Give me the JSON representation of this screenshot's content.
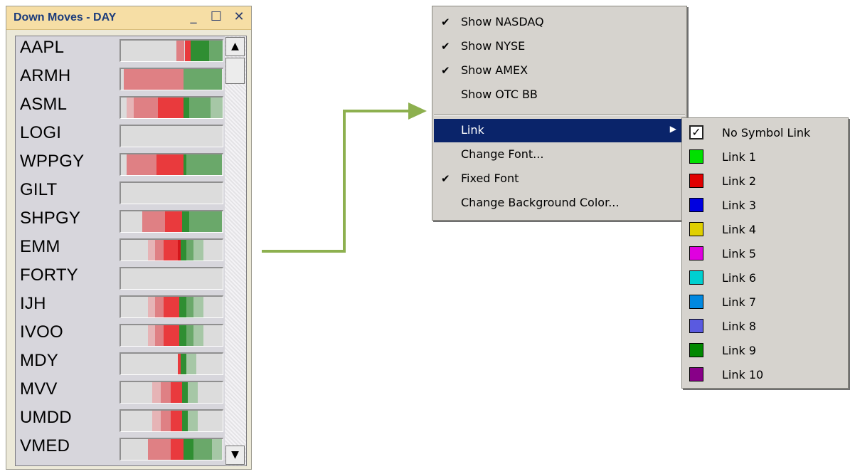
{
  "window": {
    "title": "Down Moves - DAY",
    "controls": {
      "minimize": "_",
      "maximize": "☐",
      "close": "✕"
    }
  },
  "scroll": {
    "up": "▲",
    "down": "▼"
  },
  "rows": [
    {
      "symbol": "AAPL",
      "segments": [
        [
          "light-red",
          78,
          11
        ],
        [
          "red",
          90,
          8
        ],
        [
          "green",
          98,
          26
        ],
        [
          "mid-green",
          124,
          22
        ]
      ]
    },
    {
      "symbol": "ARMH",
      "segments": [
        [
          "light-red",
          4,
          84
        ],
        [
          "mid-green",
          88,
          54
        ]
      ]
    },
    {
      "symbol": "ASML",
      "segments": [
        [
          "pale-red",
          8,
          10
        ],
        [
          "light-red",
          18,
          34
        ],
        [
          "red",
          52,
          36
        ],
        [
          "green",
          88,
          8
        ],
        [
          "mid-green",
          96,
          30
        ],
        [
          "pale-green",
          126,
          18
        ]
      ]
    },
    {
      "symbol": "LOGI",
      "segments": []
    },
    {
      "symbol": "WPPGY",
      "segments": [
        [
          "light-red",
          8,
          42
        ],
        [
          "red",
          50,
          38
        ],
        [
          "green",
          88,
          4
        ],
        [
          "mid-green",
          92,
          50
        ]
      ]
    },
    {
      "symbol": "GILT",
      "segments": []
    },
    {
      "symbol": "SHPGY",
      "segments": [
        [
          "light-red",
          30,
          32
        ],
        [
          "red",
          62,
          24
        ],
        [
          "green",
          86,
          10
        ],
        [
          "mid-green",
          96,
          46
        ]
      ]
    },
    {
      "symbol": "EMM",
      "segments": [
        [
          "pale-red",
          38,
          10
        ],
        [
          "light-red",
          48,
          12
        ],
        [
          "red",
          60,
          20
        ],
        [
          "dark-red",
          80,
          4
        ],
        [
          "green",
          84,
          8
        ],
        [
          "mid-green",
          92,
          10
        ],
        [
          "pale-green",
          102,
          14
        ]
      ]
    },
    {
      "symbol": "FORTY",
      "segments": []
    },
    {
      "symbol": "IJH",
      "segments": [
        [
          "pale-red",
          38,
          10
        ],
        [
          "light-red",
          48,
          12
        ],
        [
          "red",
          60,
          22
        ],
        [
          "green",
          82,
          10
        ],
        [
          "mid-green",
          92,
          10
        ],
        [
          "pale-green",
          102,
          14
        ]
      ]
    },
    {
      "symbol": "IVOO",
      "segments": [
        [
          "pale-red",
          38,
          10
        ],
        [
          "light-red",
          48,
          12
        ],
        [
          "red",
          60,
          22
        ],
        [
          "green",
          82,
          10
        ],
        [
          "mid-green",
          92,
          10
        ],
        [
          "pale-green",
          102,
          14
        ]
      ]
    },
    {
      "symbol": "MDY",
      "segments": [
        [
          "red",
          80,
          4
        ],
        [
          "green",
          84,
          8
        ],
        [
          "pale-green",
          92,
          14
        ]
      ]
    },
    {
      "symbol": "MVV",
      "segments": [
        [
          "pale-red",
          44,
          12
        ],
        [
          "light-red",
          56,
          14
        ],
        [
          "red",
          70,
          16
        ],
        [
          "green",
          86,
          8
        ],
        [
          "pale-green",
          94,
          14
        ]
      ]
    },
    {
      "symbol": "UMDD",
      "segments": [
        [
          "pale-red",
          44,
          12
        ],
        [
          "light-red",
          56,
          14
        ],
        [
          "red",
          70,
          16
        ],
        [
          "green",
          86,
          8
        ],
        [
          "pale-green",
          94,
          14
        ]
      ]
    },
    {
      "symbol": "VMED",
      "segments": [
        [
          "light-red",
          38,
          32
        ],
        [
          "red",
          70,
          18
        ],
        [
          "green",
          88,
          14
        ],
        [
          "mid-green",
          102,
          26
        ],
        [
          "pale-green",
          128,
          14
        ]
      ]
    }
  ],
  "colors": {
    "light-red": "#df8084",
    "red": "#e93a3d",
    "dark-red": "#d4161b",
    "pale-red": "#e6b4b6",
    "green": "#2f8e32",
    "mid-green": "#6aa86a",
    "pale-green": "#a6c7a6",
    "arrow": "#8db04f"
  },
  "menu": {
    "items": [
      {
        "label": "Show NASDAQ",
        "checked": "✔"
      },
      {
        "label": "Show NYSE",
        "checked": "✔"
      },
      {
        "label": "Show AMEX",
        "checked": "✔"
      },
      {
        "label": "Show OTC BB",
        "checked": ""
      }
    ],
    "items2": [
      {
        "label": "Link",
        "checked": "",
        "submenu": "▶"
      },
      {
        "label": "Change Font...",
        "checked": ""
      },
      {
        "label": "Fixed Font",
        "checked": "✔"
      },
      {
        "label": "Change Background Color...",
        "checked": ""
      }
    ]
  },
  "submenu": {
    "no_link": {
      "label": "No Symbol Link",
      "check": "✓"
    },
    "links": [
      {
        "label": "Link 1",
        "color": "#00e000"
      },
      {
        "label": "Link 2",
        "color": "#e00000"
      },
      {
        "label": "Link 3",
        "color": "#0000e0"
      },
      {
        "label": "Link 4",
        "color": "#e0d000"
      },
      {
        "label": "Link 5",
        "color": "#e000e0"
      },
      {
        "label": "Link 6",
        "color": "#00d0d0"
      },
      {
        "label": "Link 7",
        "color": "#0088e0"
      },
      {
        "label": "Link 8",
        "color": "#5a5ae0"
      },
      {
        "label": "Link 9",
        "color": "#008800"
      },
      {
        "label": "Link 10",
        "color": "#880088"
      }
    ]
  }
}
